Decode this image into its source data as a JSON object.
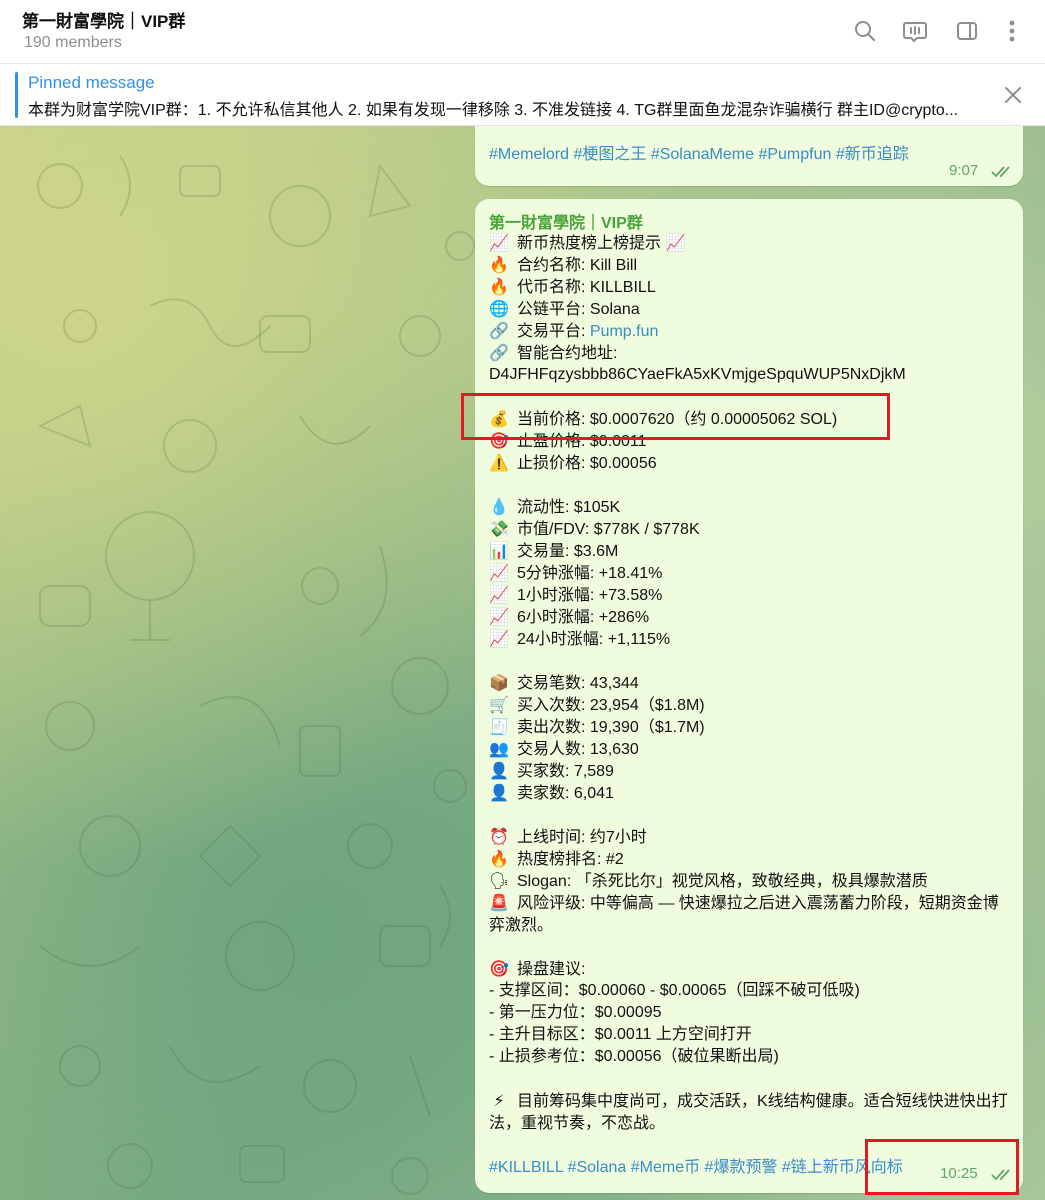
{
  "header": {
    "title": "第一財富學院｜VIP群",
    "members": "190 members",
    "icons": [
      "search-icon",
      "live-stream-icon",
      "sidebar-toggle-icon",
      "more-options-icon"
    ]
  },
  "pinned": {
    "label": "Pinned message",
    "text": "本群为财富学院VIP群：1. 不允许私信其他人 2. 如果有发现一律移除 3. 不准发链接 4. TG群里面鱼龙混杂诈骗横行 群主ID@crypto..."
  },
  "msg1": {
    "tags": "#Memelord #梗图之王 #SolanaMeme #Pumpfun #新币追踪",
    "time": "9:07"
  },
  "msg2": {
    "sender": "第一財富學院｜VIP群",
    "l01": {
      "e": "📈",
      "t": "新币热度榜上榜提示 📈"
    },
    "l02": {
      "e": "🔥",
      "t": "合约名称: Kill Bill"
    },
    "l03": {
      "e": "🔥",
      "t": "代币名称: KILLBILL"
    },
    "l04": {
      "e": "🌐",
      "t": "公链平台: Solana"
    },
    "l05": {
      "e": "🔗",
      "t": "交易平台: ",
      "link": "Pump.fun"
    },
    "l06": {
      "e": "🔗",
      "t": "智能合约地址:"
    },
    "l07": {
      "t": "D4JFHFqzysbbb86CYaeFkA5xKVmjgeSpquWUP5NxDjkM"
    },
    "l08": {
      "e": "💰",
      "t": "当前价格: $0.0007620（约 0.00005062 SOL)"
    },
    "l09": {
      "e": "🎯",
      "t": "止盈价格: $0.0011"
    },
    "l10": {
      "e": "⚠️",
      "t": "止损价格: $0.00056"
    },
    "l11": {
      "e": "💧",
      "t": "流动性: $105K"
    },
    "l12": {
      "e": "💸",
      "t": "市值/FDV: $778K / $778K"
    },
    "l13": {
      "e": "📊",
      "t": "交易量: $3.6M"
    },
    "l14": {
      "e": "📈",
      "t": "5分钟涨幅: +18.41%"
    },
    "l15": {
      "e": "📈",
      "t": "1小时涨幅: +73.58%"
    },
    "l16": {
      "e": "📈",
      "t": "6小时涨幅: +286%"
    },
    "l17": {
      "e": "📈",
      "t": "24小时涨幅: +1,115%"
    },
    "l18": {
      "e": "📦",
      "t": "交易笔数: 43,344"
    },
    "l19": {
      "e": "🛒",
      "t": "买入次数: 23,954（$1.8M)"
    },
    "l20": {
      "e": "🧾",
      "t": "卖出次数: 19,390（$1.7M)"
    },
    "l21": {
      "e": "👥",
      "t": "交易人数: 13,630"
    },
    "l22": {
      "e": "👤",
      "t": "买家数: 7,589"
    },
    "l23": {
      "e": "👤",
      "t": "卖家数: 6,041"
    },
    "l24": {
      "e": "⏰",
      "t": "上线时间: 约7小时"
    },
    "l25": {
      "e": "🔥",
      "t": "热度榜排名: #2"
    },
    "l26": {
      "e": "🗣",
      "t": "Slogan: 「杀死比尔」视觉风格，致敬经典，极具爆款潜质"
    },
    "l27": {
      "e": "🚨",
      "t": "风险评级: 中等偏高 — 快速爆拉之后进入震荡蓄力阶段，短期资金博弈激烈。"
    },
    "l28": {
      "e": "🎯",
      "t": "操盘建议:"
    },
    "l29": {
      "t": "- 支撑区间：$0.00060 - $0.00065（回踩不破可低吸)"
    },
    "l30": {
      "t": "- 第一压力位：$0.00095"
    },
    "l31": {
      "t": "- 主升目标区：$0.0011 上方空间打开"
    },
    "l32": {
      "t": "- 止损参考位：$0.00056（破位果断出局)"
    },
    "l33": {
      "e": "⚡",
      "t": "目前筹码集中度尚可，成交活跃，K线结构健康。适合短线快进快出打法，重视节奏，不恋战。"
    },
    "tags": "#KILLBILL #Solana #Meme币 #爆款预警 #链上新币风向标",
    "time": "10:25"
  },
  "colors": {
    "accent": "#3390ec",
    "bubble": "#effdde",
    "sender": "#4aa33a",
    "link": "#3a8cc6",
    "highlight": "#e01b24"
  }
}
